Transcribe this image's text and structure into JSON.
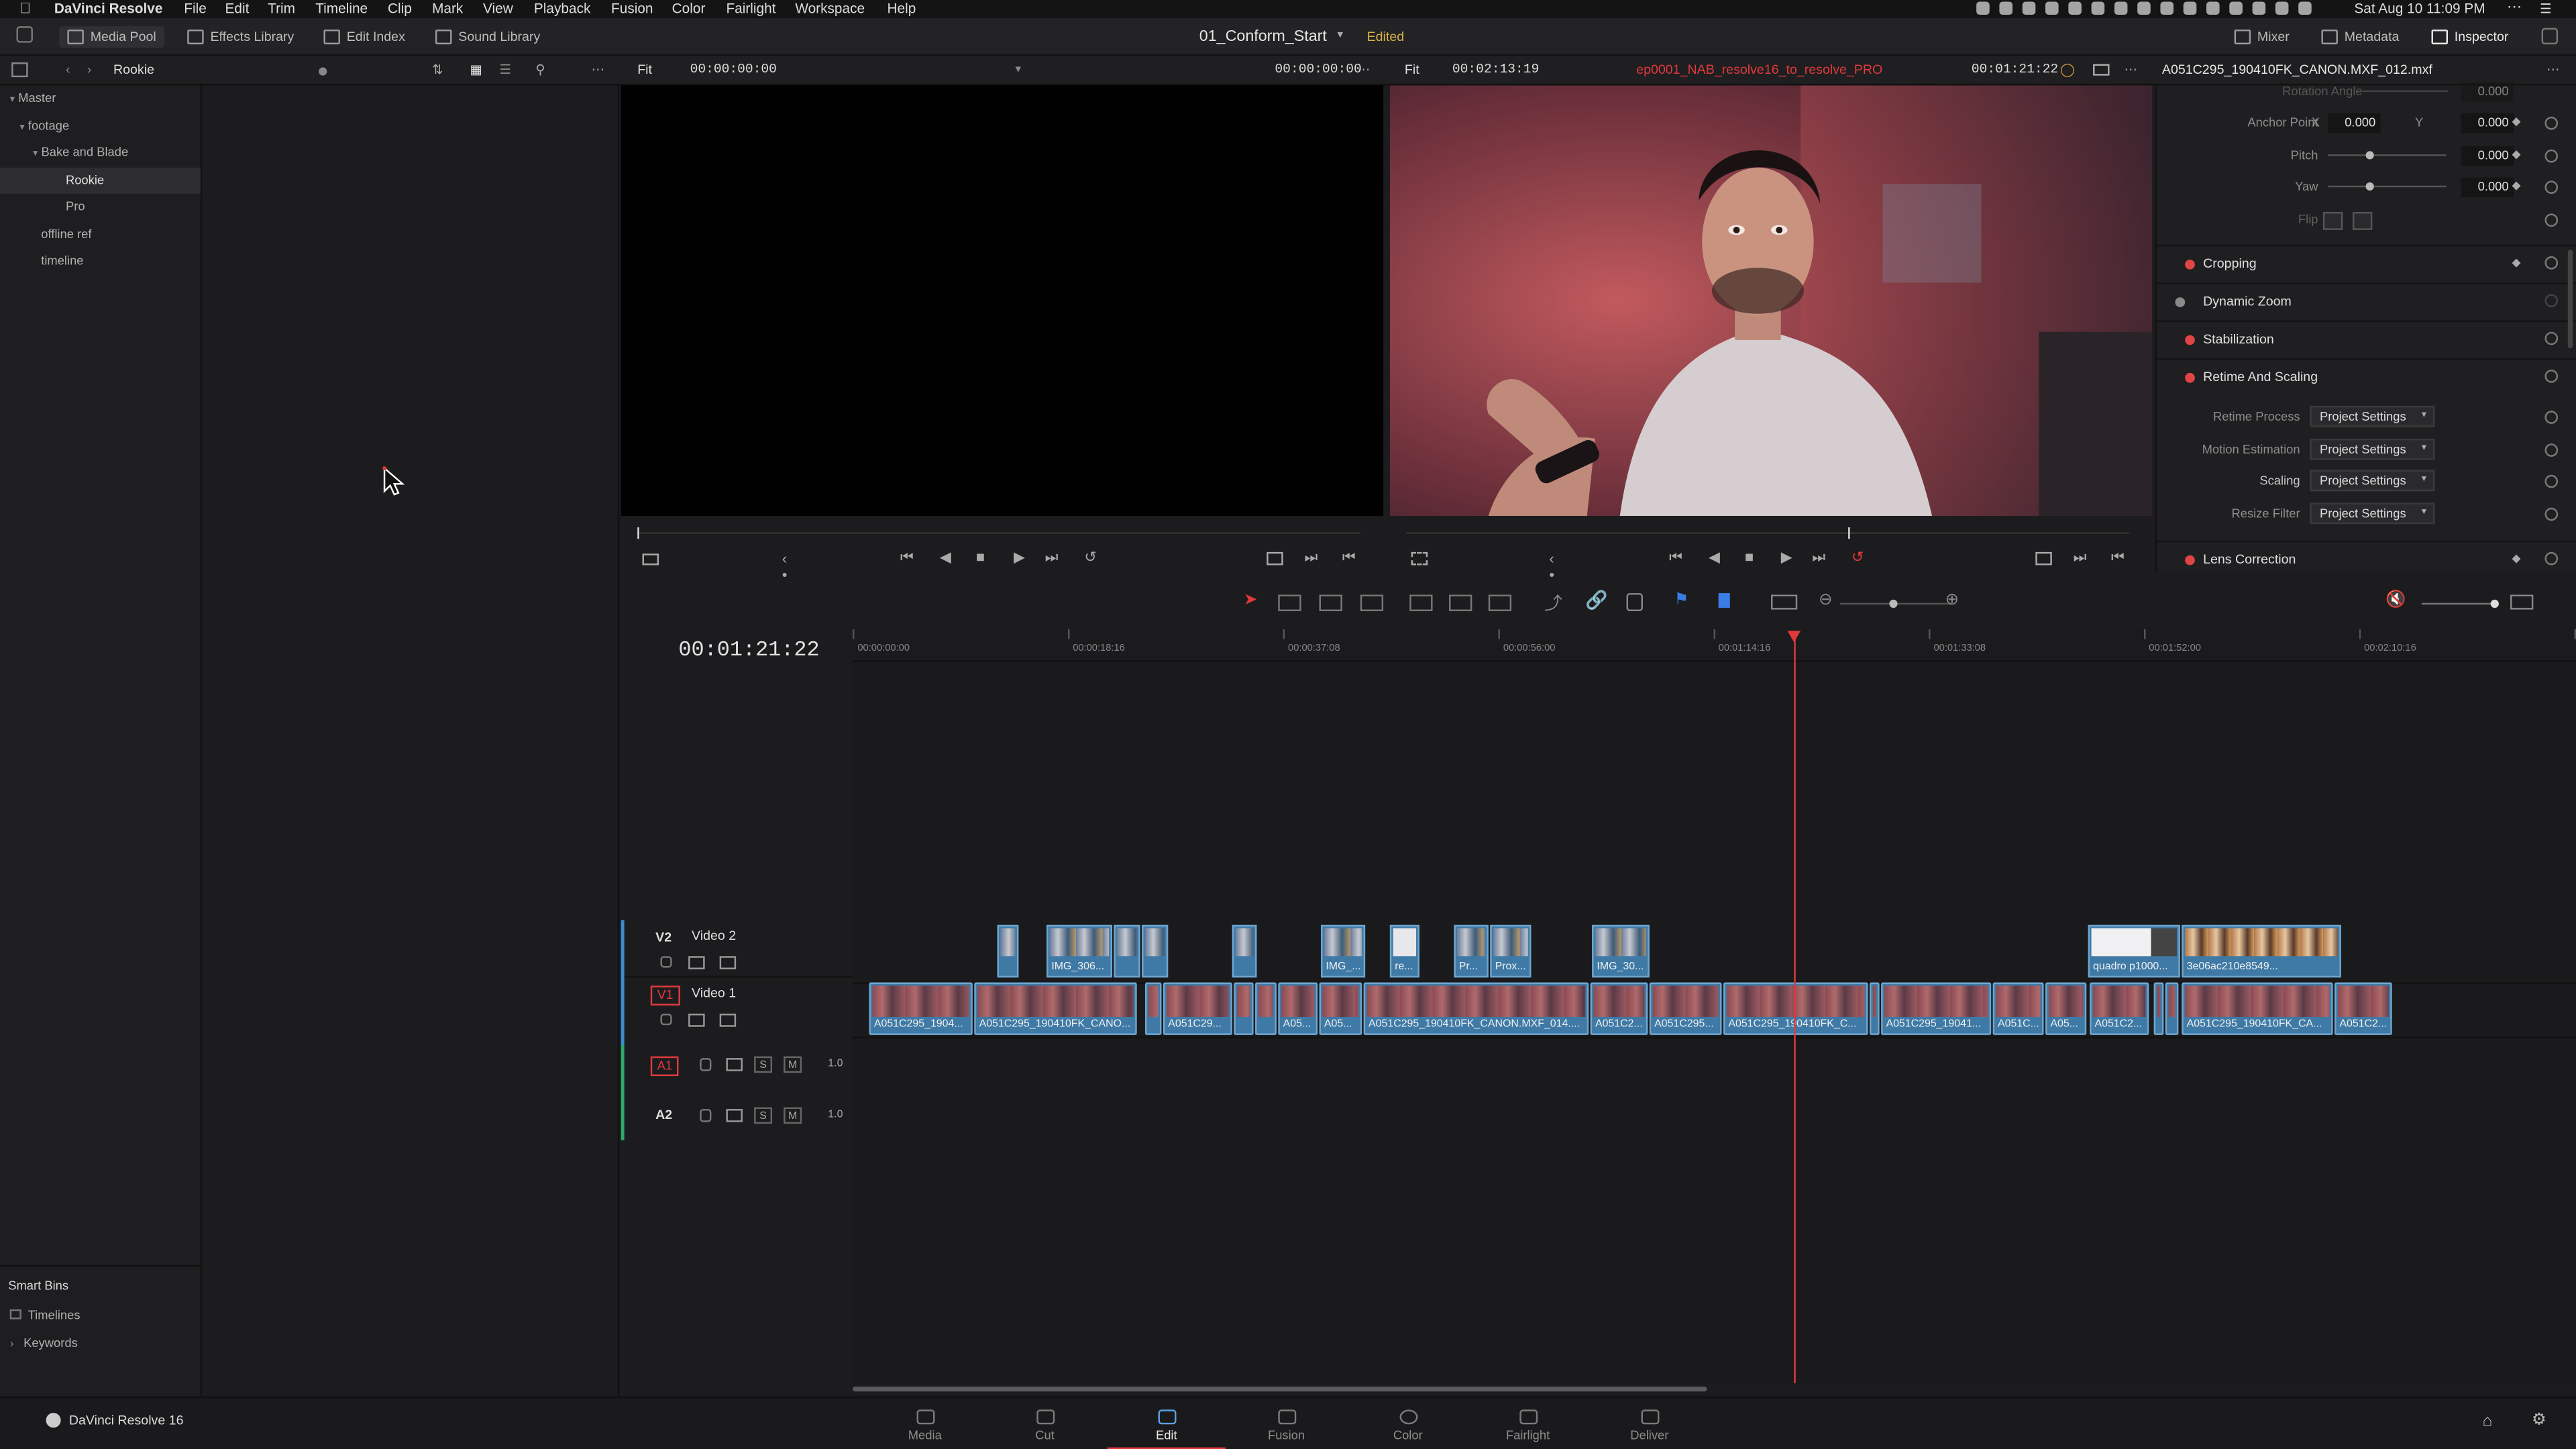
{
  "menubar": {
    "app_name": "DaVinci Resolve",
    "menus": [
      "File",
      "Edit",
      "Trim",
      "Timeline",
      "Clip",
      "Mark",
      "View",
      "Playback",
      "Fusion",
      "Color",
      "Fairlight",
      "Workspace",
      "Help"
    ],
    "clock": "Sat Aug 10  11:09 PM"
  },
  "toolbar": {
    "media_pool": "Media Pool",
    "effects_library": "Effects Library",
    "edit_index": "Edit Index",
    "sound_library": "Sound Library",
    "timeline_name": "01_Conform_Start",
    "edited_badge": "Edited",
    "mixer": "Mixer",
    "metadata": "Metadata",
    "inspector": "Inspector"
  },
  "bar2": {
    "bin_name": "Rookie",
    "left_fit": "Fit",
    "left_tc_in": "00:00:00:00",
    "left_tc_out": "00:00:00:00",
    "right_fit": "Fit",
    "right_duration": "00:02:13:19",
    "timeline_dropdown": "ep0001_NAB_resolve16_to_resolve_PRO",
    "right_tc": "00:01:21:22",
    "clip_name": "A051C295_190410FK_CANON.MXF_012.mxf"
  },
  "bins": {
    "master": "Master",
    "footage": "footage",
    "bake_and_blade": "Bake and Blade",
    "rookie": "Rookie",
    "pro": "Pro",
    "offline_ref": "offline ref",
    "timeline": "timeline"
  },
  "smart_bins": {
    "title": "Smart Bins",
    "timelines": "Timelines",
    "keywords": "Keywords"
  },
  "inspector": {
    "rotation_angle_label": "Rotation Angle",
    "rotation_angle": "0.000",
    "anchor_point_label": "Anchor Point",
    "anchor_x_label": "X",
    "anchor_x": "0.000",
    "anchor_y_label": "Y",
    "anchor_y": "0.000",
    "pitch_label": "Pitch",
    "pitch": "0.000",
    "yaw_label": "Yaw",
    "yaw": "0.000",
    "flip_label": "Flip",
    "cropping": "Cropping",
    "dynamic_zoom": "Dynamic Zoom",
    "stabilization": "Stabilization",
    "retime_and_scaling": "Retime And Scaling",
    "retime_process_label": "Retime Process",
    "retime_process": "Project Settings",
    "motion_estimation_label": "Motion Estimation",
    "motion_estimation": "Project Settings",
    "scaling_label": "Scaling",
    "scaling": "Project Settings",
    "resize_filter_label": "Resize Filter",
    "resize_filter": "Project Settings",
    "lens_correction": "Lens Correction"
  },
  "timeline": {
    "current_tc": "00:01:21:22",
    "ruler": [
      "00:00:00:00",
      "00:00:18:16",
      "00:00:37:08",
      "00:00:56:00",
      "00:01:14:16",
      "00:01:33:08",
      "00:01:52:00",
      "00:02:10:16"
    ],
    "tracks": {
      "v2_id": "V2",
      "v2_name": "Video 2",
      "v1_id": "V1",
      "v1_name": "Video 1",
      "a1_id": "A1",
      "a2_id": "A2",
      "solo": "S",
      "mute": "M",
      "a1_level": "1.0",
      "a2_level": "1.0"
    },
    "v1_clips": [
      "A051C295_1904...",
      "A051C295_190410FK_CANO...",
      "A051C29...",
      "A05...",
      "A05...",
      "A051C295_190410FK_CANON.MXF_014....",
      "A051C2...",
      "A051C295...",
      "A051C295_190410FK_C...",
      "A051C295_19041...",
      "A051C...",
      "A05...",
      "A051C2...",
      "A051C295_190410FK_CA...",
      "A051C2..."
    ],
    "v2_clips": [
      "IMG_306...",
      "IMG_...",
      "re...",
      "Pr...",
      "Prox...",
      "IMG_30...",
      "quadro p1000...",
      "3e06ac210e8549..."
    ]
  },
  "pages": [
    "Media",
    "Cut",
    "Edit",
    "Fusion",
    "Color",
    "Fairlight",
    "Deliver"
  ],
  "active_page": "Edit",
  "footer_app": "DaVinci Resolve 16"
}
